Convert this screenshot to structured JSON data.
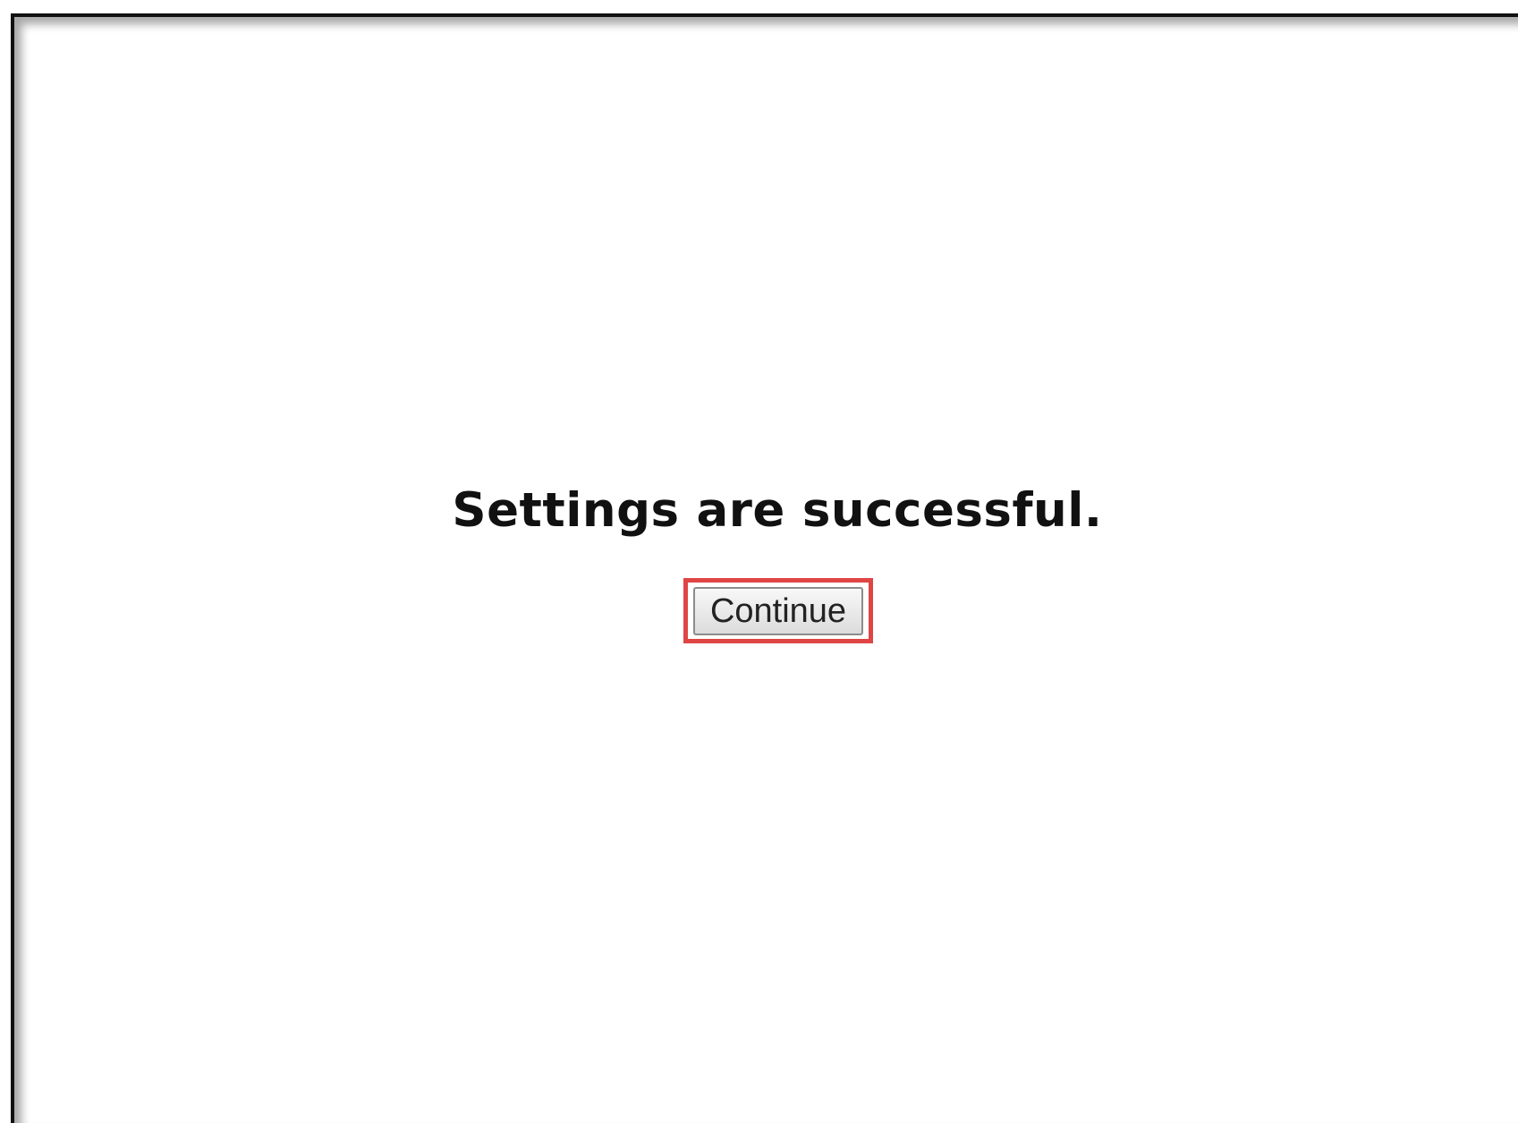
{
  "message": {
    "text": "Settings are successful."
  },
  "continue_button": {
    "label": "Continue",
    "highlight_color": "#e04545"
  }
}
